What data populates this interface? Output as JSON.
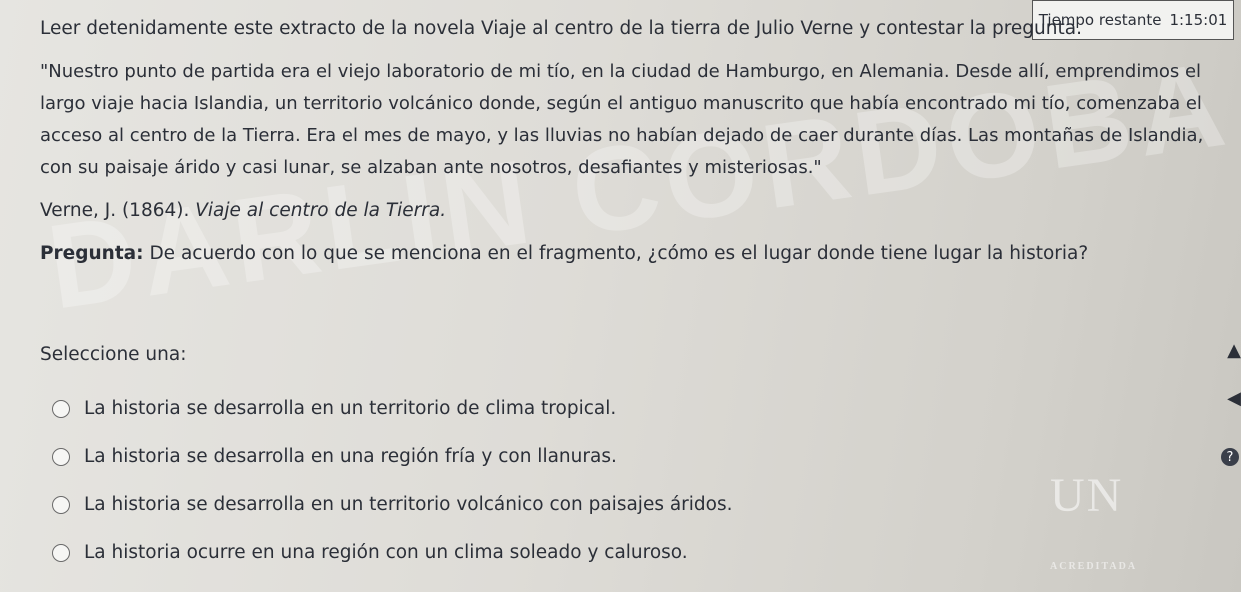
{
  "timer": {
    "label": "Tiempo restante",
    "value": "1:15:01"
  },
  "instruction": "Leer detenidamente este extracto de la novela Viaje al centro de la tierra de Julio Verne y contestar la pregunta.",
  "quote": "\"Nuestro punto de partida era el viejo laboratorio de mi tío, en la ciudad de Hamburgo, en Alemania. Desde allí, emprendimos el largo viaje hacia Islandia, un territorio volcánico donde, según el antiguo manuscrito que había encontrado mi tío, comenzaba el acceso al centro de la Tierra. Era el mes de mayo, y las lluvias no habían dejado de caer durante días. Las montañas de Islandia, con su paisaje árido y casi lunar, se alzaban ante nosotros, desafiantes y misteriosas.\"",
  "citation": {
    "author": "Verne, J. (1864).",
    "title": "Viaje al centro de la Tierra."
  },
  "question": {
    "label": "Pregunta:",
    "text": "De acuerdo con lo que se menciona en el fragmento, ¿cómo es el lugar donde tiene lugar la historia?"
  },
  "select_label": "Seleccione una:",
  "options": [
    "La historia se desarrolla en un territorio de clima tropical.",
    "La historia se desarrolla en una región fría y con llanuras.",
    "La historia se desarrolla en un territorio volcánico con paisajes áridos.",
    "La historia ocurre en una región con un clima soleado y caluroso."
  ],
  "watermark": "DARLIN CORDOBA MARTINEZ",
  "logo": {
    "mark": "UN",
    "sub": "ACREDITADA"
  },
  "icons": {
    "help": "help-icon",
    "up": "chevron-up-icon",
    "back": "arrow-left-icon"
  }
}
